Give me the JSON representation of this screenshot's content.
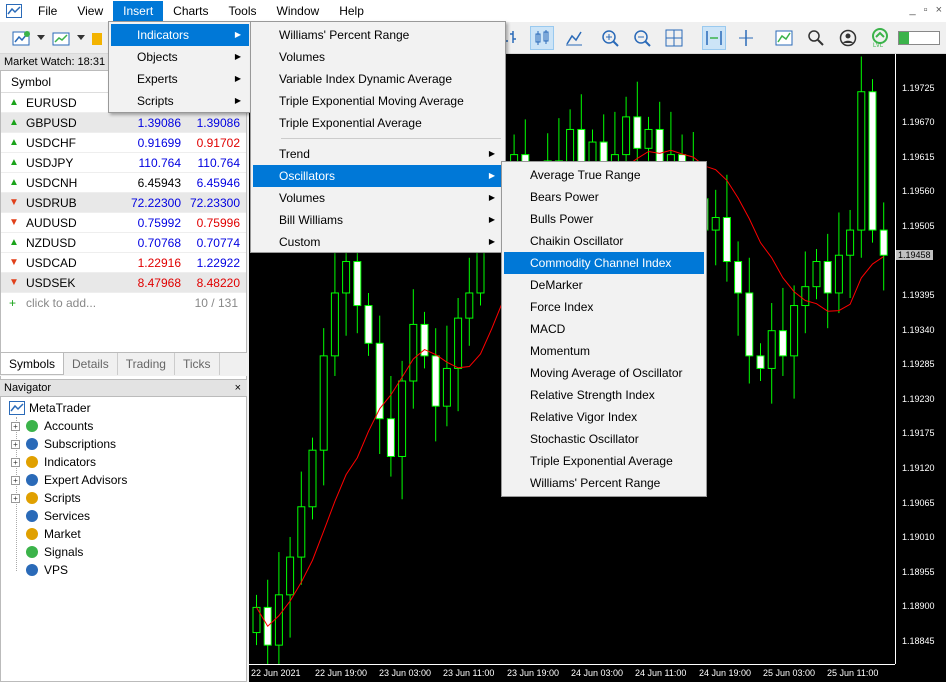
{
  "menubar": {
    "items": [
      "File",
      "View",
      "Insert",
      "Charts",
      "Tools",
      "Window",
      "Help"
    ],
    "active": "Insert"
  },
  "window_controls": [
    "_",
    "▫",
    "×"
  ],
  "market_watch": {
    "title": "Market Watch: 18:31",
    "header": "Symbol",
    "rows": [
      {
        "dir": "up",
        "symbol": "EURUSD",
        "bid": "",
        "ask": "",
        "bid_color": "blue",
        "ask_color": "blue"
      },
      {
        "dir": "up",
        "symbol": "GBPUSD",
        "bid": "1.39086",
        "ask": "1.39086",
        "bid_color": "blue",
        "ask_color": "blue"
      },
      {
        "dir": "up",
        "symbol": "USDCHF",
        "bid": "0.91699",
        "ask": "0.91702",
        "bid_color": "blue",
        "ask_color": "red"
      },
      {
        "dir": "up",
        "symbol": "USDJPY",
        "bid": "110.764",
        "ask": "110.764",
        "bid_color": "blue",
        "ask_color": "blue"
      },
      {
        "dir": "up",
        "symbol": "USDCNH",
        "bid": "6.45943",
        "ask": "6.45946",
        "bid_color": "black",
        "ask_color": "blue"
      },
      {
        "dir": "down",
        "symbol": "USDRUB",
        "bid": "72.22300",
        "ask": "72.23300",
        "bid_color": "blue",
        "ask_color": "blue"
      },
      {
        "dir": "down",
        "symbol": "AUDUSD",
        "bid": "0.75992",
        "ask": "0.75996",
        "bid_color": "blue",
        "ask_color": "red"
      },
      {
        "dir": "up",
        "symbol": "NZDUSD",
        "bid": "0.70768",
        "ask": "0.70774",
        "bid_color": "blue",
        "ask_color": "blue"
      },
      {
        "dir": "down",
        "symbol": "USDCAD",
        "bid": "1.22916",
        "ask": "1.22922",
        "bid_color": "red",
        "ask_color": "blue"
      },
      {
        "dir": "down",
        "symbol": "USDSEK",
        "bid": "8.47968",
        "ask": "8.48220",
        "bid_color": "red",
        "ask_color": "red"
      }
    ],
    "add_label": "click to add...",
    "count": "10 / 131",
    "tabs": [
      "Symbols",
      "Details",
      "Trading",
      "Ticks"
    ]
  },
  "navigator": {
    "title": "Navigator",
    "close": "×",
    "root": "MetaTrader",
    "items": [
      {
        "label": "Accounts",
        "expandable": true
      },
      {
        "label": "Subscriptions",
        "expandable": true
      },
      {
        "label": "Indicators",
        "expandable": true
      },
      {
        "label": "Expert Advisors",
        "expandable": true
      },
      {
        "label": "Scripts",
        "expandable": true
      },
      {
        "label": "Services",
        "expandable": false
      },
      {
        "label": "Market",
        "expandable": false
      },
      {
        "label": "Signals",
        "expandable": false
      },
      {
        "label": "VPS",
        "expandable": false
      }
    ]
  },
  "insert_menu": {
    "items": [
      "Indicators",
      "Objects",
      "Experts",
      "Scripts"
    ],
    "selected": "Indicators"
  },
  "indicators_menu": {
    "top_items": [
      "Williams' Percent Range",
      "Volumes",
      "Variable Index Dynamic Average",
      "Triple Exponential Moving Average",
      "Triple Exponential Average"
    ],
    "sub_items": [
      "Trend",
      "Oscillators",
      "Volumes",
      "Bill Williams",
      "Custom"
    ],
    "selected": "Oscillators"
  },
  "oscillators_menu": {
    "items": [
      "Average True Range",
      "Bears Power",
      "Bulls Power",
      "Chaikin Oscillator",
      "Commodity Channel Index",
      "DeMarker",
      "Force Index",
      "MACD",
      "Momentum",
      "Moving Average of Oscillator",
      "Relative Strength Index",
      "Relative Vigor Index",
      "Stochastic Oscillator",
      "Triple Exponential Average",
      "Williams' Percent Range"
    ],
    "selected": "Commodity Channel Index"
  },
  "chart": {
    "price_labels": [
      "1.19725",
      "1.19670",
      "1.19615",
      "1.19560",
      "1.19505",
      "1.19395",
      "1.19340",
      "1.19285",
      "1.19230",
      "1.19175",
      "1.19120",
      "1.19065",
      "1.19010",
      "1.18955",
      "1.18900",
      "1.18845"
    ],
    "current_price": "1.19458",
    "time_labels": [
      "22 Jun 2021",
      "22 Jun 19:00",
      "23 Jun 03:00",
      "23 Jun 11:00",
      "23 Jun 19:00",
      "24 Jun 03:00",
      "24 Jun 11:00",
      "24 Jun 19:00",
      "25 Jun 03:00",
      "25 Jun 11:00"
    ],
    "colors": {
      "background": "#000000",
      "candle": "#00ff00",
      "ma_line": "#ff0000"
    }
  },
  "chart_data": {
    "type": "candlestick",
    "y_range": [
      1.1881,
      1.1978
    ],
    "current_price": 1.19458,
    "closes": [
      1.189,
      1.1884,
      1.1892,
      1.1898,
      1.1906,
      1.1915,
      1.193,
      1.194,
      1.1945,
      1.1938,
      1.1932,
      1.192,
      1.1914,
      1.1926,
      1.1935,
      1.193,
      1.1922,
      1.1928,
      1.1936,
      1.194,
      1.1952,
      1.196,
      1.1958,
      1.1962,
      1.195,
      1.1955,
      1.1961,
      1.1957,
      1.1966,
      1.196,
      1.1964,
      1.1958,
      1.1962,
      1.1968,
      1.1963,
      1.1966,
      1.1958,
      1.1962,
      1.196,
      1.1955,
      1.195,
      1.1952,
      1.1945,
      1.194,
      1.193,
      1.1928,
      1.1934,
      1.193,
      1.1938,
      1.1941,
      1.1945,
      1.194,
      1.1946,
      1.195,
      1.1972,
      1.195,
      1.1946
    ]
  }
}
